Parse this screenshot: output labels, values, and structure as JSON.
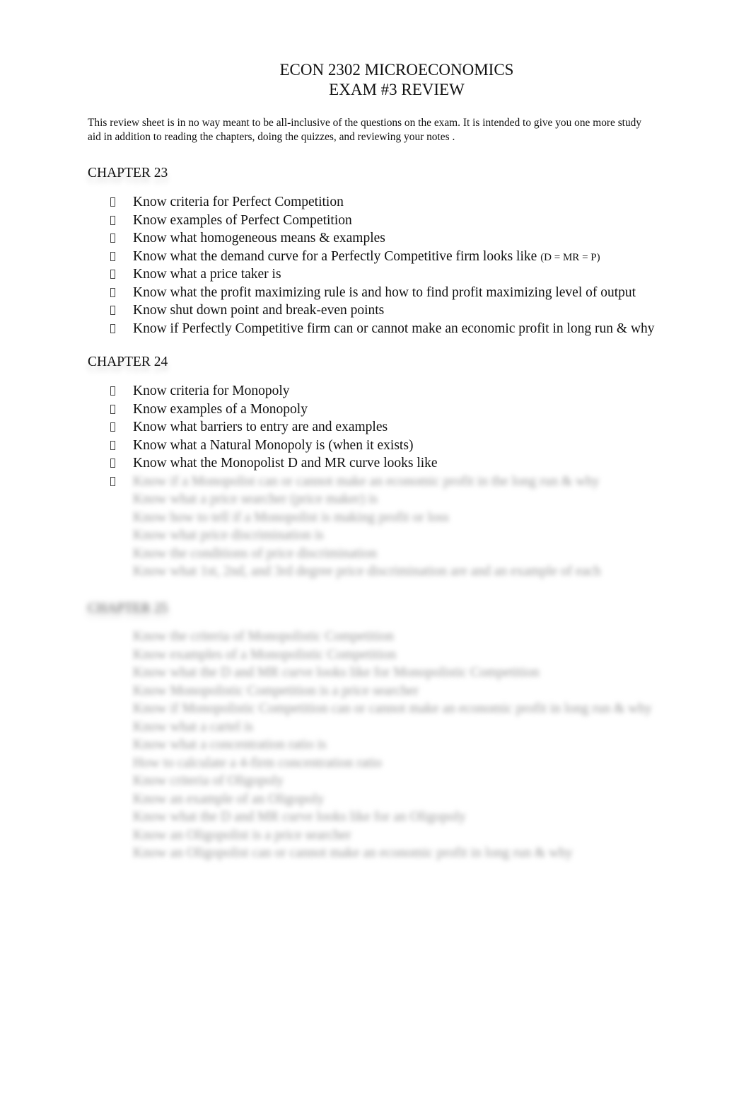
{
  "document": {
    "title_line1": "ECON 2302 MICROECONOMICS",
    "title_line2": "EXAM #3 REVIEW",
    "intro_line1": "This review sheet is in no way meant to be all-inclusive of the questions on the exam. It is intended to give you one more study",
    "intro_line2": "aid in addition to reading the chapters, doing the quizzes, and reviewing your notes .",
    "bullet_icon": "missing-glyph-box"
  },
  "chapters": [
    {
      "heading": "CHAPTER 23",
      "items": [
        {
          "text": "Know criteria for Perfect Competition"
        },
        {
          "text": "Know examples of Perfect Competition"
        },
        {
          "text": "Know what homogeneous means & examples"
        },
        {
          "text": "Know what the demand curve for a Perfectly Competitive firm looks like ",
          "note": "(D = MR = P)"
        },
        {
          "text": "Know what a price taker is"
        },
        {
          "text": "Know what the profit maximizing rule is and how to find profit maximizing level of output"
        },
        {
          "text": "Know shut down point and break-even points"
        },
        {
          "text": "Know if Perfectly Competitive firm can or cannot make an economic profit in long run & why"
        }
      ]
    },
    {
      "heading": "CHAPTER 24",
      "items": [
        {
          "text": "Know criteria for Monopoly"
        },
        {
          "text": "Know examples of a Monopoly"
        },
        {
          "text": "Know what barriers to entry are and examples"
        },
        {
          "text": "Know what a Natural Monopoly is (when it exists)"
        },
        {
          "text": "Know what the Monopolist D and MR curve looks like"
        }
      ],
      "blurred_items": [
        {
          "text": "Know if a Monopolist can or cannot make an economic profit in the long run & why"
        },
        {
          "text": "Know what a price searcher (price maker) is"
        },
        {
          "text": "Know how to tell if a Monopolist is making profit or loss"
        },
        {
          "text": "Know what price discrimination is"
        },
        {
          "text": "Know the conditions of price discrimination"
        },
        {
          "text": "Know what 1st, 2nd, and 3rd degree price discrimination are and an example of each"
        }
      ]
    },
    {
      "heading": "CHAPTER 25",
      "blurred": true,
      "blurred_items": [
        {
          "text": "Know the criteria of Monopolistic Competition"
        },
        {
          "text": "Know examples of a Monopolistic Competition"
        },
        {
          "text": "Know what the D and MR curve looks like for Monopolistic Competition"
        },
        {
          "text": "Know Monopolistic Competition is a price searcher"
        },
        {
          "text": "Know if Monopolistic Competition can or cannot make an economic profit in long run & why"
        },
        {
          "text": "Know what a cartel is"
        },
        {
          "text": "Know what a concentration ratio is"
        },
        {
          "text": "How to calculate a 4-firm concentration ratio"
        },
        {
          "text": "Know criteria of Oligopoly"
        },
        {
          "text": "Know an example of an Oligopoly"
        },
        {
          "text": "Know what the D and MR curve looks like for an Oligopoly"
        },
        {
          "text": "Know an Oligopolist is a price searcher"
        },
        {
          "text": "Know an Oligopolist can or cannot make an economic profit in long run & why"
        }
      ]
    }
  ]
}
